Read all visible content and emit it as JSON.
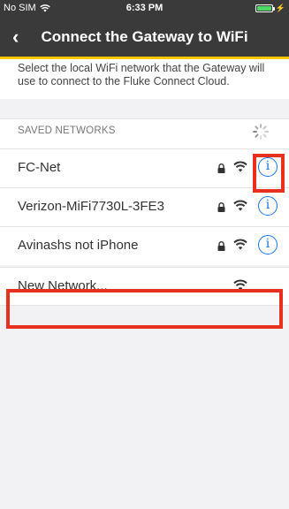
{
  "status_bar": {
    "carrier": "No SIM",
    "time": "6:33 PM",
    "charging_glyph": "⚡"
  },
  "nav": {
    "back_glyph": "‹",
    "title": "Connect the Gateway to WiFi"
  },
  "description": "Select the local WiFi network that the Gateway will use to connect to the Fluke Connect Cloud.",
  "section_header": "SAVED NETWORKS",
  "networks": [
    {
      "name": "FC-Net",
      "locked": true,
      "info": "i"
    },
    {
      "name": "Verizon-MiFi7730L-3FE3",
      "locked": true,
      "info": "i"
    },
    {
      "name": "Avinashs not iPhone",
      "locked": true,
      "info": "i"
    }
  ],
  "new_network": {
    "label": "New Network..."
  },
  "colors": {
    "header_bg": "#3a3a3a",
    "accent": "#f5c800",
    "link_blue": "#1a73e8",
    "highlight": "#e8301f",
    "battery": "#4cd964"
  }
}
